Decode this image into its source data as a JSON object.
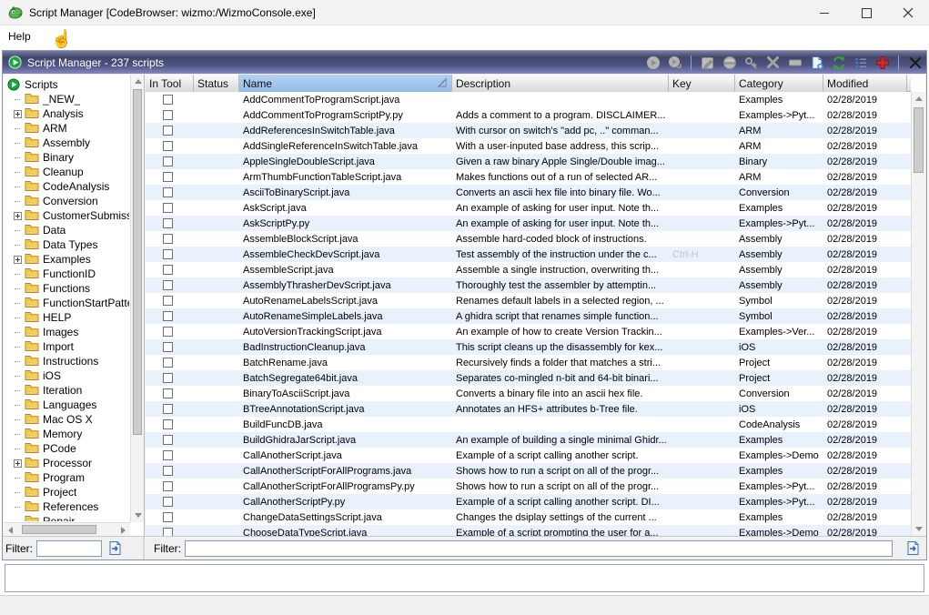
{
  "window": {
    "title": "Script Manager [CodeBrowser: wizmo:/WizmoConsole.exe]",
    "app_icon": "ghidra-dragon-icon",
    "menu": [
      "Help"
    ],
    "controls": [
      "minimize",
      "maximize",
      "close"
    ]
  },
  "panel": {
    "title": "Script Manager - 237 scripts",
    "icon": "script-manager-play-icon",
    "toolbar_icons": [
      "run-script-icon",
      "run-last-script-icon",
      "edit-script-icon",
      "eclipse-icon",
      "assign-keybinding-icon",
      "delete-script-icon",
      "rename-script-icon",
      "new-script-icon",
      "refresh-script-list-icon",
      "script-directories-icon",
      "ghidra-api-help-icon",
      "close-panel-icon"
    ]
  },
  "tree": {
    "root": "Scripts",
    "items": [
      {
        "label": "_NEW_",
        "expandable": false
      },
      {
        "label": "Analysis",
        "expandable": true
      },
      {
        "label": "ARM",
        "expandable": false
      },
      {
        "label": "Assembly",
        "expandable": false
      },
      {
        "label": "Binary",
        "expandable": false
      },
      {
        "label": "Cleanup",
        "expandable": false
      },
      {
        "label": "CodeAnalysis",
        "expandable": false
      },
      {
        "label": "Conversion",
        "expandable": false
      },
      {
        "label": "CustomerSubmissio",
        "expandable": true
      },
      {
        "label": "Data",
        "expandable": false
      },
      {
        "label": "Data Types",
        "expandable": false
      },
      {
        "label": "Examples",
        "expandable": true
      },
      {
        "label": "FunctionID",
        "expandable": false
      },
      {
        "label": "Functions",
        "expandable": false
      },
      {
        "label": "FunctionStartPatte",
        "expandable": false
      },
      {
        "label": "HELP",
        "expandable": false
      },
      {
        "label": "Images",
        "expandable": false
      },
      {
        "label": "Import",
        "expandable": false
      },
      {
        "label": "Instructions",
        "expandable": false
      },
      {
        "label": "iOS",
        "expandable": false
      },
      {
        "label": "Iteration",
        "expandable": false
      },
      {
        "label": "Languages",
        "expandable": false
      },
      {
        "label": "Mac OS X",
        "expandable": false
      },
      {
        "label": "Memory",
        "expandable": false
      },
      {
        "label": "PCode",
        "expandable": false
      },
      {
        "label": "Processor",
        "expandable": true
      },
      {
        "label": "Program",
        "expandable": false
      },
      {
        "label": "Project",
        "expandable": false
      },
      {
        "label": "References",
        "expandable": false
      },
      {
        "label": "Repair",
        "expandable": false
      }
    ]
  },
  "table": {
    "columns": [
      "In Tool",
      "Status",
      "Name",
      "Description",
      "Key",
      "Category",
      "Modified"
    ],
    "sorted_column": "Name",
    "rows": [
      {
        "name": "AddCommentToProgramScript.java",
        "description": "",
        "key": "",
        "category": "Examples",
        "modified": "02/28/2019"
      },
      {
        "name": "AddCommentToProgramScriptPy.py",
        "description": "Adds a comment to a program. DISCLAIMER...",
        "key": "",
        "category": "Examples->Pyt...",
        "modified": "02/28/2019"
      },
      {
        "name": "AddReferencesInSwitchTable.java",
        "description": "With cursor on switch's \"add pc, ..\" comman...",
        "key": "",
        "category": "ARM",
        "modified": "02/28/2019"
      },
      {
        "name": "AddSingleReferenceInSwitchTable.java",
        "description": "With a user-inputed base address, this scrip...",
        "key": "",
        "category": "ARM",
        "modified": "02/28/2019"
      },
      {
        "name": "AppleSingleDoubleScript.java",
        "description": "Given a raw binary Apple Single/Double imag...",
        "key": "",
        "category": "Binary",
        "modified": "02/28/2019"
      },
      {
        "name": "ArmThumbFunctionTableScript.java",
        "description": "Makes functions out of a run of selected AR...",
        "key": "",
        "category": "ARM",
        "modified": "02/28/2019"
      },
      {
        "name": "AsciiToBinaryScript.java",
        "description": "Converts an ascii hex file into binary file. Wo...",
        "key": "",
        "category": "Conversion",
        "modified": "02/28/2019"
      },
      {
        "name": "AskScript.java",
        "description": "An example of asking for user input. Note th...",
        "key": "",
        "category": "Examples",
        "modified": "02/28/2019"
      },
      {
        "name": "AskScriptPy.py",
        "description": "An example of asking for user input. Note th...",
        "key": "",
        "category": "Examples->Pyt...",
        "modified": "02/28/2019"
      },
      {
        "name": "AssembleBlockScript.java",
        "description": "Assemble hard-coded block of instructions.",
        "key": "",
        "category": "Assembly",
        "modified": "02/28/2019"
      },
      {
        "name": "AssembleCheckDevScript.java",
        "description": "Test assembly of the instruction under the c...",
        "key": "Ctrl-H",
        "category": "Assembly",
        "modified": "02/28/2019"
      },
      {
        "name": "AssembleScript.java",
        "description": "Assemble a single instruction, overwriting th...",
        "key": "",
        "category": "Assembly",
        "modified": "02/28/2019"
      },
      {
        "name": "AssemblyThrasherDevScript.java",
        "description": "Thoroughly test the assembler by attemptin...",
        "key": "",
        "category": "Assembly",
        "modified": "02/28/2019"
      },
      {
        "name": "AutoRenameLabelsScript.java",
        "description": "Renames default labels in a selected region, ...",
        "key": "",
        "category": "Symbol",
        "modified": "02/28/2019"
      },
      {
        "name": "AutoRenameSimpleLabels.java",
        "description": "A ghidra script that renames simple function...",
        "key": "",
        "category": "Symbol",
        "modified": "02/28/2019"
      },
      {
        "name": "AutoVersionTrackingScript.java",
        "description": "An example of how to create Version Trackin...",
        "key": "",
        "category": "Examples->Ver...",
        "modified": "02/28/2019"
      },
      {
        "name": "BadInstructionCleanup.java",
        "description": "This script cleans up the disassembly for kex...",
        "key": "",
        "category": "iOS",
        "modified": "02/28/2019"
      },
      {
        "name": "BatchRename.java",
        "description": "Recursively finds a folder that matches a stri...",
        "key": "",
        "category": "Project",
        "modified": "02/28/2019"
      },
      {
        "name": "BatchSegregate64bit.java",
        "description": "Separates co-mingled n-bit and 64-bit binari...",
        "key": "",
        "category": "Project",
        "modified": "02/28/2019"
      },
      {
        "name": "BinaryToAsciiScript.java",
        "description": "Converts a binary file into an ascii hex file.",
        "key": "",
        "category": "Conversion",
        "modified": "02/28/2019"
      },
      {
        "name": "BTreeAnnotationScript.java",
        "description": "Annotates an HFS+ attributes b-Tree file.",
        "key": "",
        "category": "iOS",
        "modified": "02/28/2019"
      },
      {
        "name": "BuildFuncDB.java",
        "description": "",
        "key": "",
        "category": "CodeAnalysis",
        "modified": "02/28/2019"
      },
      {
        "name": "BuildGhidraJarScript.java",
        "description": "An example of building a single minimal Ghidr...",
        "key": "",
        "category": "Examples",
        "modified": "02/28/2019"
      },
      {
        "name": "CallAnotherScript.java",
        "description": "Example of a script calling another script.",
        "key": "",
        "category": "Examples->Demo",
        "modified": "02/28/2019"
      },
      {
        "name": "CallAnotherScriptForAllPrograms.java",
        "description": "Shows how to run a script on all of the progr...",
        "key": "",
        "category": "Examples",
        "modified": "02/28/2019"
      },
      {
        "name": "CallAnotherScriptForAllProgramsPy.py",
        "description": "Shows how to run a script on all of the progr...",
        "key": "",
        "category": "Examples->Pyt...",
        "modified": "02/28/2019"
      },
      {
        "name": "CallAnotherScriptPy.py",
        "description": "Example of a script calling another script. DI...",
        "key": "",
        "category": "Examples->Pyt...",
        "modified": "02/28/2019"
      },
      {
        "name": "ChangeDataSettingsScript.java",
        "description": "Changes the dsiplay settings of the current ...",
        "key": "",
        "category": "Examples",
        "modified": "02/28/2019"
      },
      {
        "name": "ChooseDataTypeScript.java",
        "description": "Example of a script prompting the user for a...",
        "key": "",
        "category": "Examples->Demo",
        "modified": "02/28/2019"
      }
    ]
  },
  "filters": {
    "left_label": "Filter:",
    "left_value": "",
    "right_label": "Filter:",
    "right_value": "",
    "options_icon": "filter-options-icon"
  },
  "colors": {
    "panel_header_top": "#434769",
    "panel_header_bottom": "#8389bf",
    "row_alt": "#e9f1fc",
    "sorted_header": "#94bbea",
    "key_text": "#c2c6cd",
    "folder": "#f3cf63",
    "root_play": "#18a73c",
    "refresh_green": "#2eaa2e",
    "api_help_red": "#d42a2a"
  }
}
